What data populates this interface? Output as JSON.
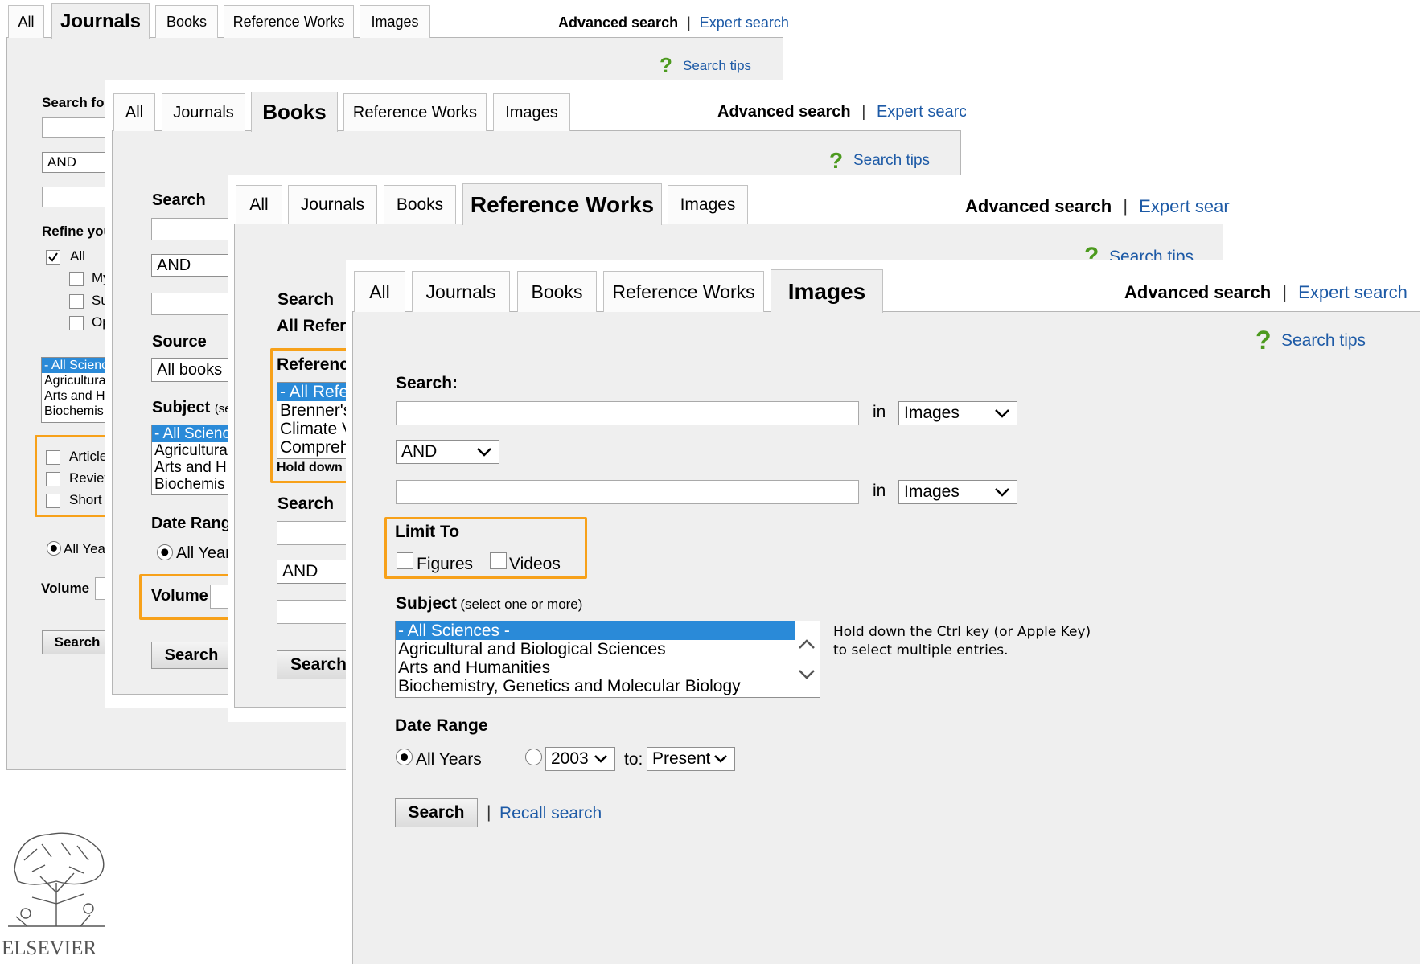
{
  "tabs": {
    "all": "All",
    "journals": "Journals",
    "books": "Books",
    "reference_works": "Reference Works",
    "images": "Images"
  },
  "links": {
    "advanced": "Advanced search",
    "separator": "|",
    "expert": "Expert search",
    "tips": "Search tips",
    "recall": "Recall search"
  },
  "tips_icon": "?",
  "journals": {
    "search_for_label": "Search for",
    "bool_value": "AND",
    "refine_label": "Refine your search",
    "refine_options": [
      "All",
      "My",
      "Su",
      "Op"
    ],
    "subjects": [
      "- All Sciences -",
      "Agricultural",
      "Arts and H",
      "Biochemis"
    ],
    "types": [
      "Articles",
      "Reviews",
      "Short"
    ],
    "all_years": "All Years",
    "volume_label": "Volume",
    "search_button": "Search"
  },
  "books": {
    "search_label": "Search",
    "bool_value": "AND",
    "source_label": "Source",
    "source_value": "All books",
    "subject_label": "Subject",
    "subject_hint": "(se",
    "subjects": [
      "- All Sciences -",
      "Agricultural",
      "Arts and H",
      "Biochemis"
    ],
    "date_range_label": "Date Range",
    "all_years": "All Years",
    "volume_label": "Volume",
    "search_button": "Search"
  },
  "reference_works": {
    "search_label": "Search",
    "source_heading": "All Reference Works",
    "box_title": "Reference Works",
    "items": [
      "- All Reference Works -",
      "Brenner's",
      "Climate V",
      "Comprehe"
    ],
    "hint": "Hold down the Ctrl key",
    "search_label_2": "Search",
    "bool_value": "AND",
    "search_button": "Search"
  },
  "images": {
    "search_label": "Search:",
    "in_label": "in",
    "field_value": "Images",
    "bool_value": "AND",
    "limit_to_label": "Limit To",
    "figures_label": "Figures",
    "videos_label": "Videos",
    "subject_label": "Subject",
    "subject_hint": "(select one or more)",
    "subjects": [
      "- All Sciences -",
      "Agricultural and Biological Sciences",
      "Arts and Humanities",
      "Biochemistry, Genetics and Molecular Biology"
    ],
    "multi_select_hint_1": "Hold down the Ctrl key (or Apple Key)",
    "multi_select_hint_2": "to select multiple entries.",
    "date_range_label": "Date Range",
    "all_years_label": "All Years",
    "from_year": "2003",
    "to_label": "to:",
    "to_value": "Present",
    "search_button": "Search",
    "all_years_selected": true,
    "figures_checked": false,
    "videos_checked": false
  },
  "logo": {
    "text": "ELSEVIER"
  },
  "colors": {
    "link": "#1d5aa6",
    "highlight": "#f7a11a",
    "selected": "#2a8ad8",
    "tips_icon": "#4c9a1e"
  }
}
